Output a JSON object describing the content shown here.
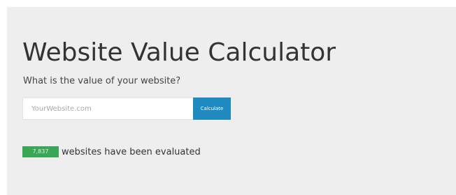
{
  "header": {
    "title": "Website Value Calculator",
    "subtitle": "What is the value of your website?"
  },
  "form": {
    "placeholder": "YourWebsite.com",
    "value": "",
    "button_label": "Calculate"
  },
  "stats": {
    "count": "7,837",
    "label": "websites have been evaluated"
  },
  "colors": {
    "panel_background": "#eeeeee",
    "button": "#1f8ac0",
    "badge": "#3aa757"
  }
}
